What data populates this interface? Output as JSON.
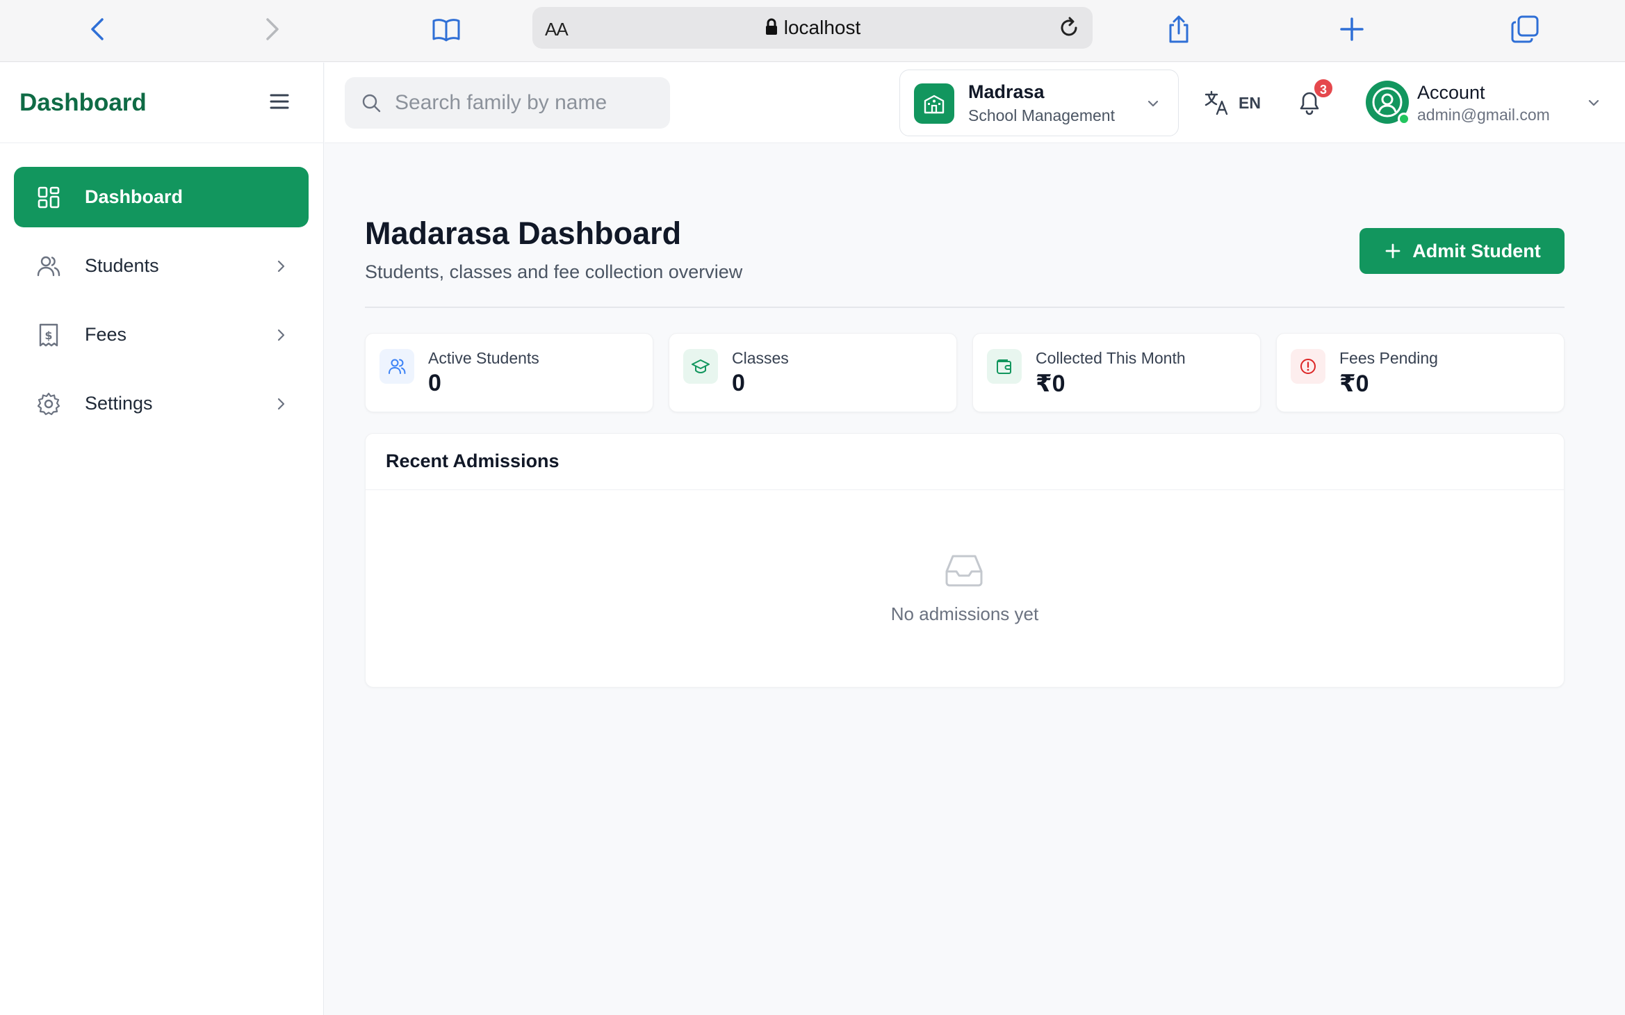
{
  "browser": {
    "aa_label": "AA",
    "url": "localhost"
  },
  "sidebar": {
    "brand": "Dashboard",
    "items": [
      {
        "label": "Dashboard",
        "active": true,
        "icon": "grid-icon"
      },
      {
        "label": "Students",
        "active": false,
        "icon": "users-icon"
      },
      {
        "label": "Fees",
        "active": false,
        "icon": "receipt-icon"
      },
      {
        "label": "Settings",
        "active": false,
        "icon": "gear-icon"
      }
    ]
  },
  "header": {
    "search_placeholder": "Search family by name",
    "org": {
      "name": "Madrasa",
      "subtitle": "School Management"
    },
    "language": "EN",
    "notification_count": "3",
    "account": {
      "name": "Account",
      "email": "admin@gmail.com"
    }
  },
  "main": {
    "title": "Madarasa Dashboard",
    "subtitle": "Students, classes and fee collection overview",
    "admit_button": "Admit Student",
    "stats": [
      {
        "label": "Active Students",
        "value": "0",
        "icon": "users-icon"
      },
      {
        "label": "Classes",
        "value": "0",
        "icon": "graduation-cap-icon"
      },
      {
        "label": "Collected This Month",
        "value": "₹0",
        "icon": "wallet-icon"
      },
      {
        "label": "Fees Pending",
        "value": "₹0",
        "icon": "alert-icon"
      }
    ],
    "recent": {
      "title": "Recent Admissions",
      "empty_text": "No admissions yet"
    }
  },
  "colors": {
    "primary": "#12965e",
    "brand_text": "#0f6b45",
    "badge": "#e5484d",
    "browser_accent": "#2f6fd6"
  }
}
